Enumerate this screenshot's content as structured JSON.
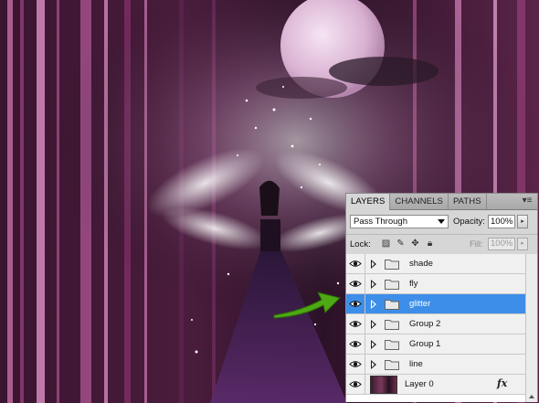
{
  "artwork": {
    "description_icon": "fairy-forest-artwork"
  },
  "panel": {
    "tabs": [
      {
        "label": "LAYERS",
        "active": true
      },
      {
        "label": "CHANNELS",
        "active": false
      },
      {
        "label": "PATHS",
        "active": false
      }
    ],
    "menu_icon": "panel-menu-icon",
    "blend_mode": "Pass Through",
    "opacity_label": "Opacity:",
    "opacity_value": "100%",
    "lock_label": "Lock:",
    "fill_label": "Fill:",
    "fill_value": "100%",
    "layers": [
      {
        "name": "shade",
        "type": "group",
        "visible": true,
        "selected": false
      },
      {
        "name": "fly",
        "type": "group",
        "visible": true,
        "selected": false
      },
      {
        "name": "glitter",
        "type": "group",
        "visible": true,
        "selected": true
      },
      {
        "name": "Group 2",
        "type": "group",
        "visible": true,
        "selected": false
      },
      {
        "name": "Group 1",
        "type": "group",
        "visible": true,
        "selected": false
      },
      {
        "name": "line",
        "type": "group",
        "visible": true,
        "selected": false
      },
      {
        "name": "Layer 0",
        "type": "layer",
        "visible": true,
        "selected": false,
        "fx": "fx"
      }
    ]
  },
  "colors": {
    "selection": "#3d8ee8",
    "arrow": "#3f9a10",
    "forest": "#7a2a5a"
  }
}
